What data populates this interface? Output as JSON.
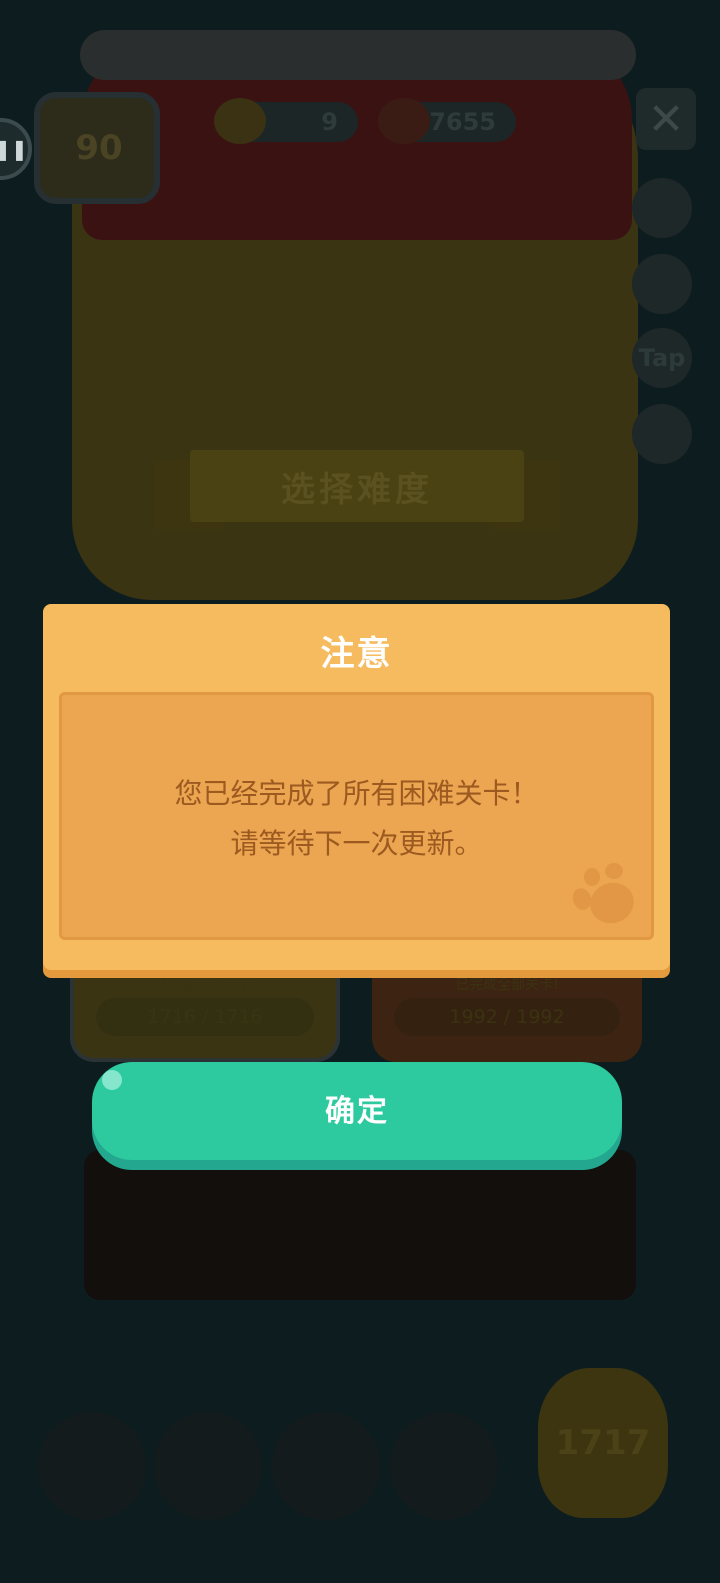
{
  "background": {
    "home_level": "90",
    "pause_glyph": "❚❚",
    "currency_1": "9",
    "currency_2": "7655",
    "close_glyph": "✕",
    "tap_label": "Tap",
    "difficulty_banner": "选择难度",
    "card_left": {
      "status": "已完成全部关卡!",
      "progress": "1716 / 1716"
    },
    "card_right": {
      "status": "已完成全部关卡!",
      "progress": "1992 / 1992"
    },
    "gold_count": "1717"
  },
  "dialog": {
    "title": "注意",
    "message_line1": "您已经完成了所有困难关卡！",
    "message_line2": "请等待下一次更新。",
    "confirm_label": "确定"
  },
  "colors": {
    "dialog_header": "#f6bb5e",
    "dialog_body": "#eca651",
    "message_text": "#9d5a20",
    "confirm_button": "#2dca9f"
  }
}
